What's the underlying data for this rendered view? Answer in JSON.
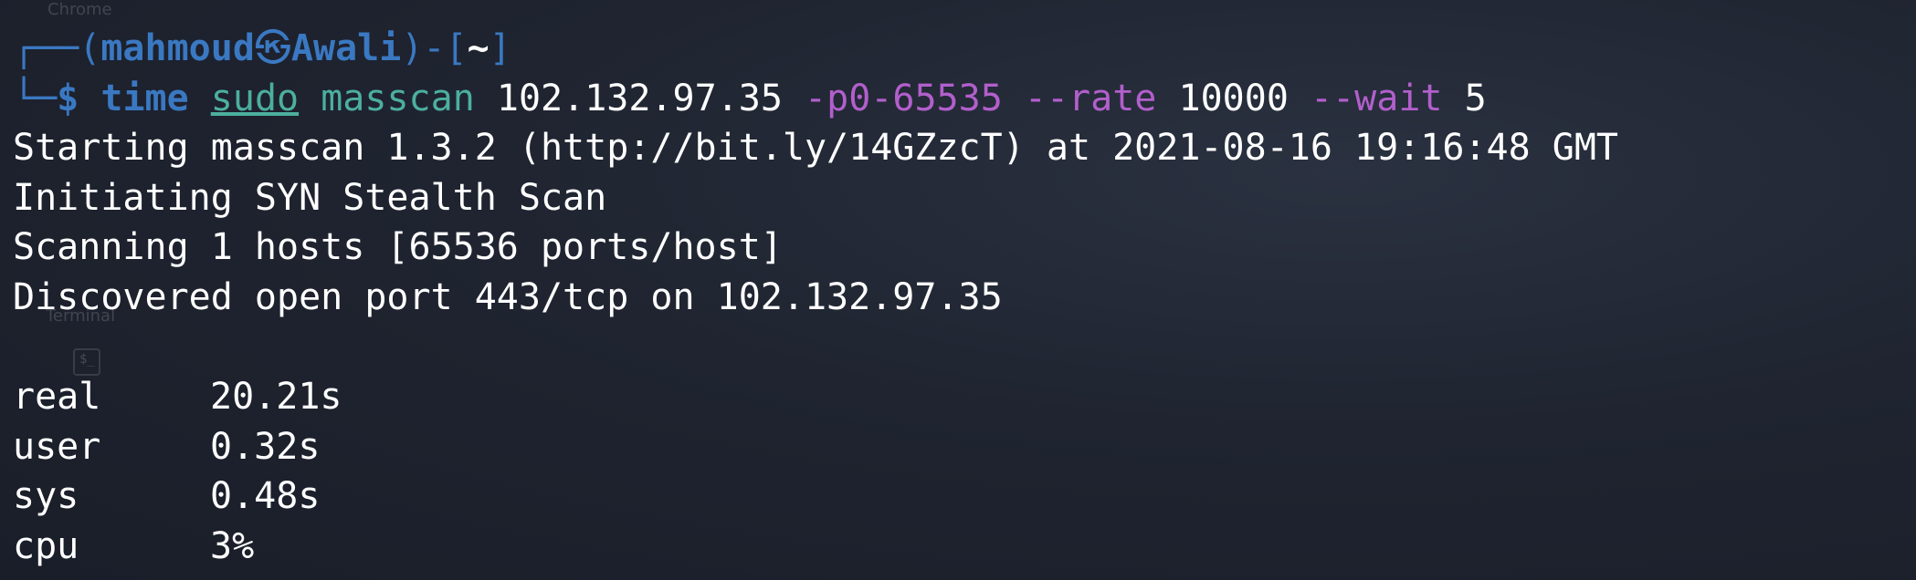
{
  "background": {
    "ghost_app_label_top": "Chrome",
    "ghost_app_label_bottom": "Terminal",
    "ghost_icon_glyph": "$_"
  },
  "prompt": {
    "frame_top_prefix": "┌──(",
    "user": "mahmoud",
    "separator_icon": "kali-skull-icon",
    "separator_glyph": "㉿",
    "host": "Awali",
    "frame_top_mid": ")-[",
    "cwd": "~",
    "frame_top_suffix": "]",
    "frame_bottom_prefix": "└─",
    "dollar": "$"
  },
  "command": {
    "time": "time",
    "sudo": "sudo",
    "program": "masscan",
    "target": "102.132.97.35",
    "ports_flag": "-p0-65535",
    "rate_flag": "--rate",
    "rate_value": "10000",
    "wait_flag": "--wait",
    "wait_value": "5"
  },
  "output_lines": [
    "Starting masscan 1.3.2 (http://bit.ly/14GZzcT) at 2021-08-16 19:16:48 GMT",
    "Initiating SYN Stealth Scan",
    "Scanning 1 hosts [65536 ports/host]",
    "Discovered open port 443/tcp on 102.132.97.35",
    ""
  ],
  "timing": [
    {
      "label": "real",
      "value": "20.21s"
    },
    {
      "label": "user",
      "value": "0.32s"
    },
    {
      "label": "sys",
      "value": "0.48s"
    },
    {
      "label": "cpu",
      "value": "3%"
    }
  ],
  "colors": {
    "prompt_blue": "#3a78c2",
    "command_green": "#4caf9e",
    "option_purple": "#b25fcc",
    "text_white": "#ffffff",
    "background": "#1f2430"
  }
}
